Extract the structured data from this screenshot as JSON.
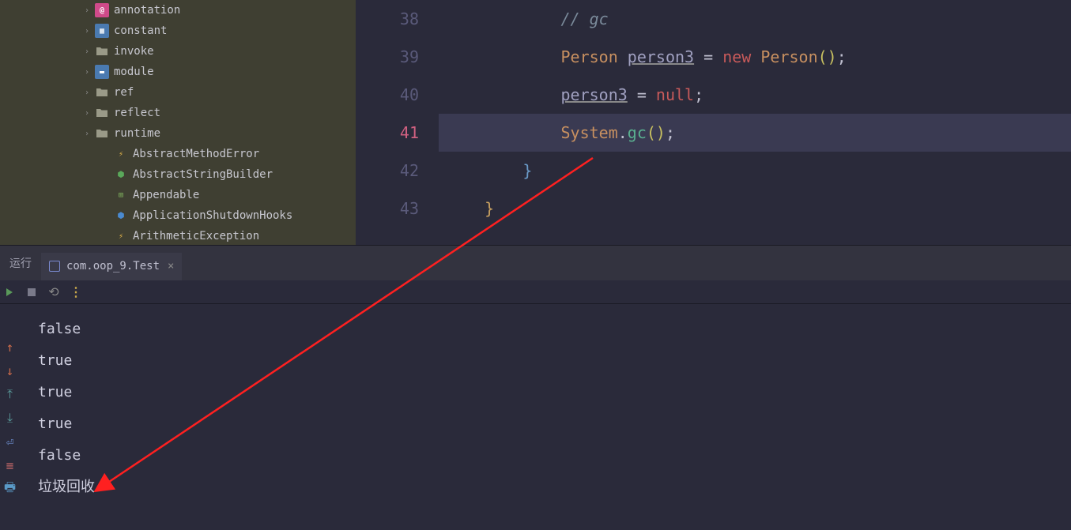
{
  "sidebar": {
    "items": [
      {
        "indent": 100,
        "chev": "right",
        "icon": "pkg-pink",
        "label": "annotation"
      },
      {
        "indent": 100,
        "chev": "right",
        "icon": "pkg-blue",
        "label": "constant"
      },
      {
        "indent": 100,
        "chev": "right",
        "icon": "folder",
        "label": "invoke"
      },
      {
        "indent": 100,
        "chev": "right",
        "icon": "pkg-blue",
        "label": "module"
      },
      {
        "indent": 100,
        "chev": "right",
        "icon": "folder",
        "label": "ref"
      },
      {
        "indent": 100,
        "chev": "right",
        "icon": "folder",
        "label": "reflect"
      },
      {
        "indent": 100,
        "chev": "right",
        "icon": "folder",
        "label": "runtime"
      },
      {
        "indent": 124,
        "chev": "none",
        "icon": "class-y",
        "label": "AbstractMethodError"
      },
      {
        "indent": 124,
        "chev": "none",
        "icon": "class-g",
        "label": "AbstractStringBuilder"
      },
      {
        "indent": 124,
        "chev": "none",
        "icon": "int-g",
        "label": "Appendable"
      },
      {
        "indent": 124,
        "chev": "none",
        "icon": "class-b",
        "label": "ApplicationShutdownHooks"
      },
      {
        "indent": 124,
        "chev": "none",
        "icon": "class-y",
        "label": "ArithmeticException"
      }
    ]
  },
  "editor": {
    "lines": [
      {
        "n": "38",
        "hl": false
      },
      {
        "n": "39",
        "hl": false
      },
      {
        "n": "40",
        "hl": false
      },
      {
        "n": "41",
        "hl": true
      },
      {
        "n": "42",
        "hl": false
      },
      {
        "n": "43",
        "hl": false
      }
    ],
    "code": {
      "l38_comment": "// gc",
      "l39_type": "Person",
      "l39_var": "person3",
      "l39_eq": " = ",
      "l39_new": "new",
      "l39_ctor": " Person",
      "l39_paren": "()",
      "l39_semi": ";",
      "l40_var": "person3",
      "l40_eq": " = ",
      "l40_null": "null",
      "l40_semi": ";",
      "l41_sys": "System",
      "l41_dot": ".",
      "l41_gc": "gc",
      "l41_paren": "()",
      "l41_semi": ";",
      "l42_brace": "}",
      "l43_brace": "}"
    }
  },
  "run_panel": {
    "title_prefix": "运行",
    "tab_label": "com.oop_9.Test",
    "output": [
      "false",
      "true",
      "true",
      "true",
      "false",
      "垃圾回收"
    ]
  }
}
